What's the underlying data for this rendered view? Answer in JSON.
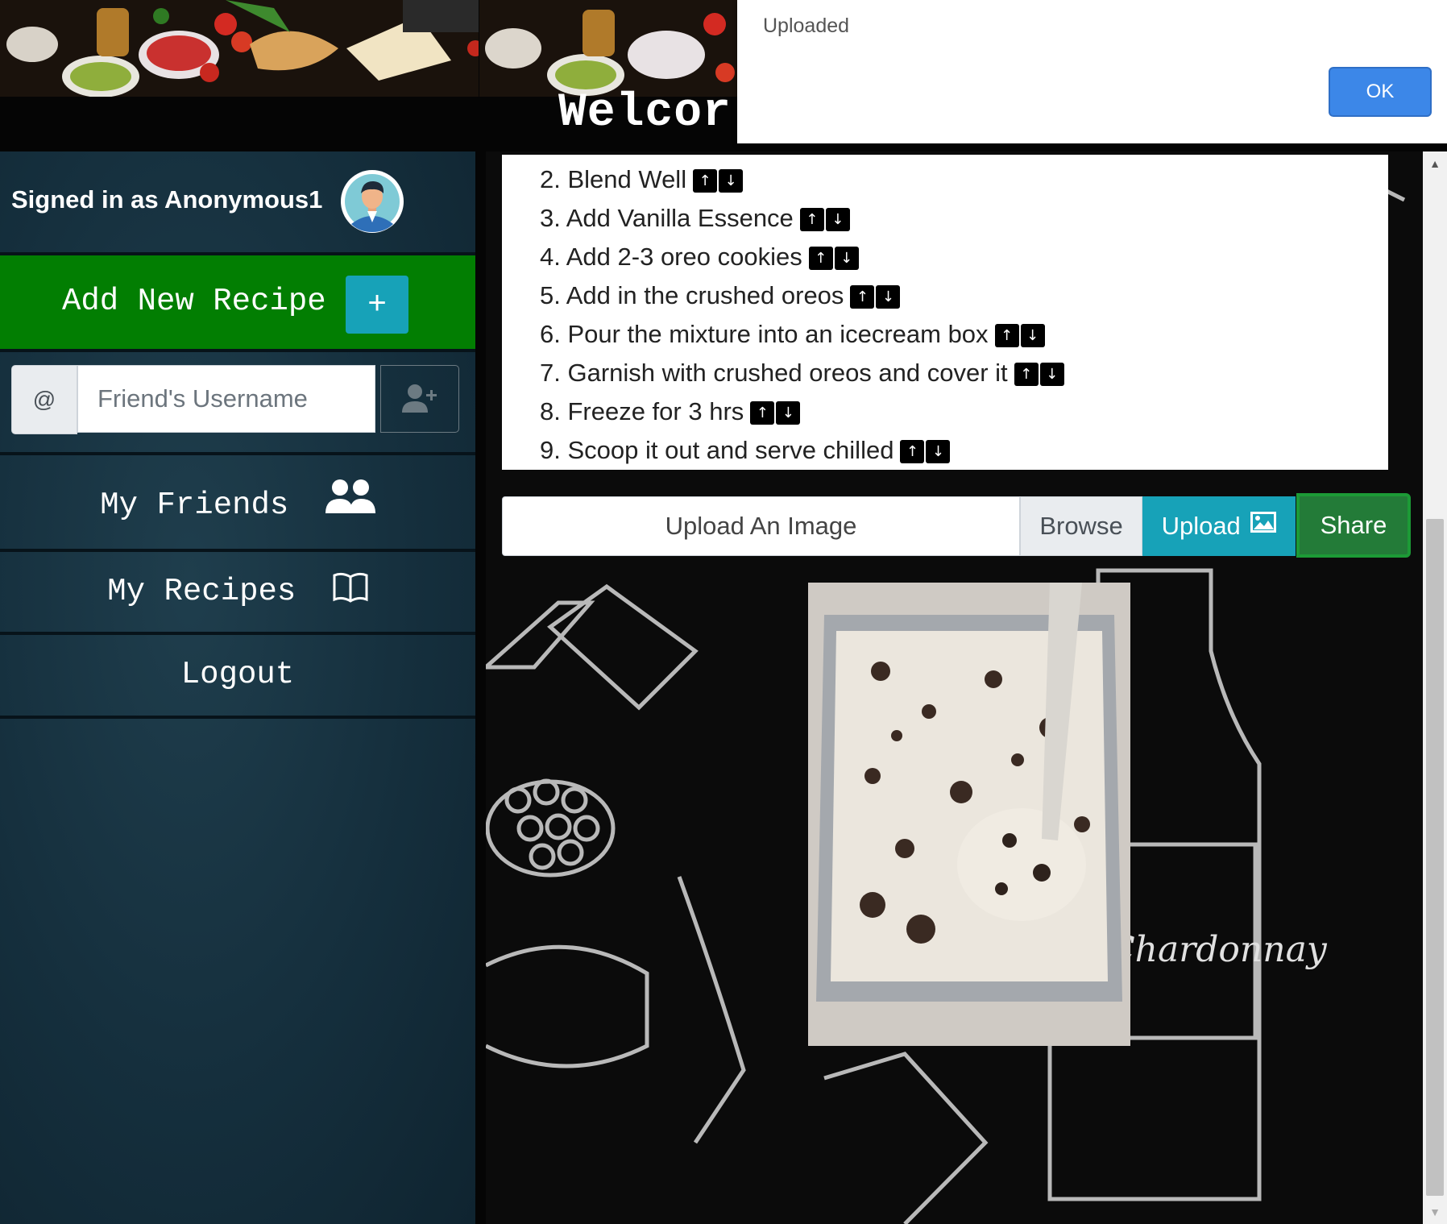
{
  "header": {
    "welcome_text": "Welcor"
  },
  "dialog": {
    "message": "Uploaded",
    "ok_label": "OK"
  },
  "sidebar": {
    "signed_in_text": "Signed in as Anonymous1",
    "add_recipe_label": "Add New Recipe",
    "add_recipe_plus": "+",
    "friend_prefix": "@",
    "friend_placeholder": "Friend's Username",
    "nav": {
      "friends_label": "My Friends",
      "recipes_label": "My Recipes",
      "logout_label": "Logout"
    }
  },
  "steps": [
    {
      "text": "2. Blend Well"
    },
    {
      "text": "3. Add Vanilla Essence"
    },
    {
      "text": "4. Add 2-3 oreo cookies"
    },
    {
      "text": "5. Add in the crushed oreos"
    },
    {
      "text": "6. Pour the mixture into an icecream box"
    },
    {
      "text": "7. Garnish with crushed oreos and cover it"
    },
    {
      "text": "8. Freeze for 3 hrs"
    },
    {
      "text": "9. Scoop it out and serve chilled"
    }
  ],
  "arrows": {
    "up": "↑",
    "down": "↓"
  },
  "upload": {
    "field_label": "Upload An Image",
    "browse_label": "Browse",
    "upload_label": "Upload",
    "share_label": "Share"
  },
  "scrollbar": {
    "up": "▲",
    "down": "▼"
  },
  "colors": {
    "add_recipe_bg": "#027e02",
    "accent_teal": "#17a2b8",
    "share_green": "#237b38",
    "dialog_ok": "#3c87e8",
    "sidebar_bg": "#1a3442"
  },
  "icons": [
    "avatar",
    "plus-icon",
    "add-user-icon",
    "users-icon",
    "book-open-icon",
    "image-icon",
    "arrow-up-icon",
    "arrow-down-icon"
  ]
}
